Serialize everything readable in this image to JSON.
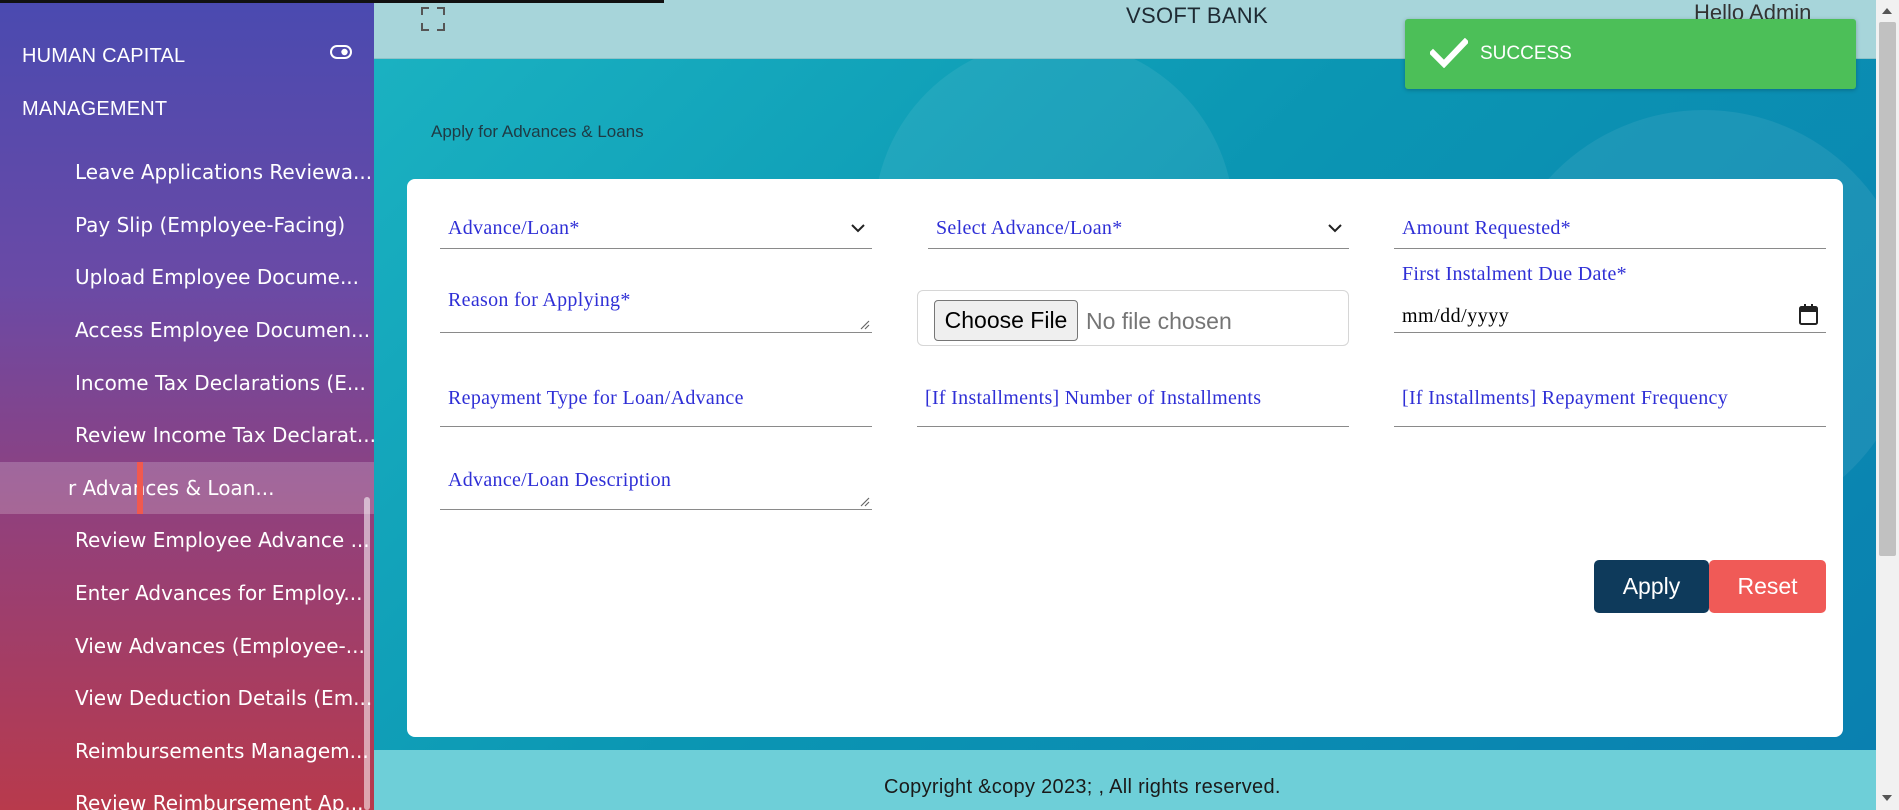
{
  "sidebar": {
    "title_line1": "HUMAN CAPITAL",
    "title_line2": "MANAGEMENT",
    "items": [
      {
        "label": "Leave Applications Reviewa..."
      },
      {
        "label": "Pay Slip (Employee-Facing)"
      },
      {
        "label": "Upload Employee Docume..."
      },
      {
        "label": "Access Employee Documen..."
      },
      {
        "label": "Income Tax Declarations (E..."
      },
      {
        "label": "Review Income Tax Declarat..."
      },
      {
        "label": "r Advances & Loan..."
      },
      {
        "label": "Review Employee Advance ..."
      },
      {
        "label": "Enter Advances for Employ..."
      },
      {
        "label": "View Advances (Employee-..."
      },
      {
        "label": "View Deduction Details (Em..."
      },
      {
        "label": "Reimbursements Managem..."
      },
      {
        "label": "Review Reimbursement Ap..."
      }
    ]
  },
  "header": {
    "bank_name": "VSOFT BANK",
    "greeting": "Hello Admin"
  },
  "page": {
    "subtitle": "Apply for Advances & Loans"
  },
  "form": {
    "advance_loan_label": "Advance/Loan*",
    "select_advance_loan_label": "Select Advance/Loan*",
    "amount_requested_label": "Amount Requested*",
    "reason_label": "Reason for Applying*",
    "file_button": "Choose File",
    "file_status": "No file chosen",
    "first_due_date_label": "First Instalment Due Date*",
    "first_due_date_value": "mm/dd/yyyy",
    "repayment_type_label": "Repayment Type for Loan/Advance",
    "num_installments_label": "[If Installments] Number of Installments",
    "repayment_frequency_label": "[If Installments] Repayment Frequency",
    "description_label": "Advance/Loan Description",
    "apply_label": "Apply",
    "reset_label": "Reset"
  },
  "footer": {
    "text": "Copyright &copy 2023; , All rights reserved."
  },
  "toast": {
    "text": "SUCCESS"
  },
  "colors": {
    "apply": "#0e3a5b",
    "reset": "#f05a57",
    "toast": "#4cbf58",
    "label": "#2f2fd6"
  }
}
